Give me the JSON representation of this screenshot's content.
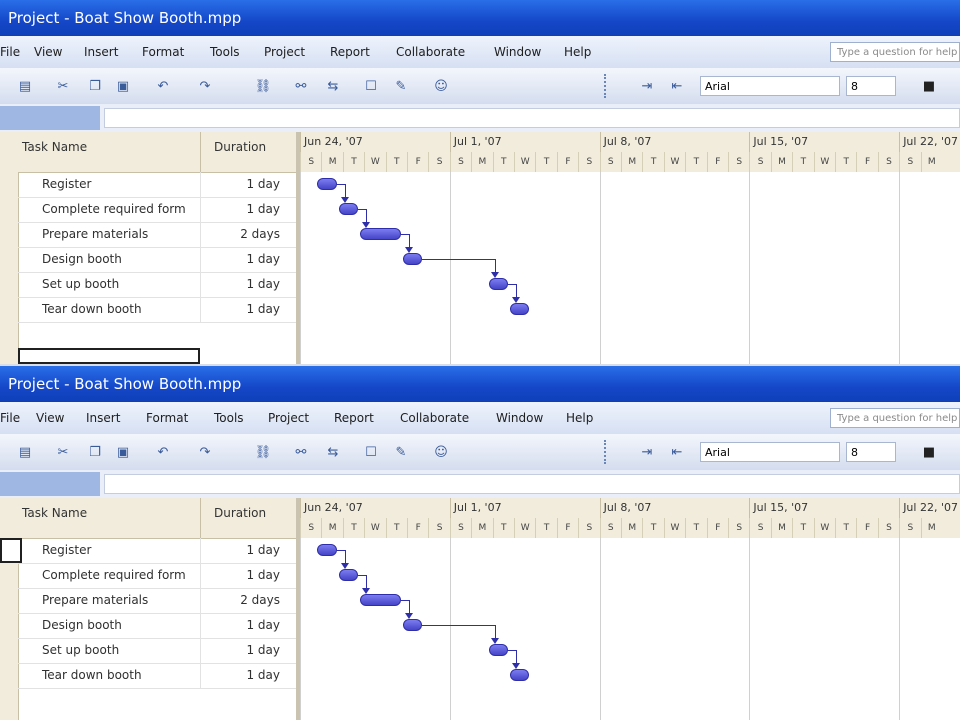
{
  "window_title": "Project - Boat Show Booth.mpp",
  "menu": [
    "File",
    "View",
    "Insert",
    "Format",
    "Tools",
    "Project",
    "Report",
    "Collaborate",
    "Window",
    "Help"
  ],
  "help_placeholder": "Type a question for help",
  "font_name": "Arial",
  "font_size": "8",
  "columns": {
    "task_name": "Task Name",
    "duration": "Duration"
  },
  "tasks": [
    {
      "name": "Register",
      "duration": "1 day"
    },
    {
      "name": "Complete required form",
      "duration": "1 day"
    },
    {
      "name": "Prepare materials",
      "duration": "2 days"
    },
    {
      "name": "Design booth",
      "duration": "1 day"
    },
    {
      "name": "Set up booth",
      "duration": "1 day"
    },
    {
      "name": "Tear down booth",
      "duration": "1 day"
    }
  ],
  "weeks": [
    "Jun 24, '07",
    "Jul 1, '07",
    "Jul 8, '07",
    "Jul 15, '07",
    "Jul 22, '07"
  ],
  "days": [
    "S",
    "M",
    "T",
    "W",
    "T",
    "F",
    "S"
  ],
  "icons": [
    "print-icon",
    "print-preview-icon",
    "cut-icon",
    "copy-icon",
    "paste-icon",
    "undo-icon",
    "redo-icon",
    "link-icon",
    "unlink-icon",
    "split-icon",
    "task-info-icon",
    "notes-icon",
    "assign-resources-icon",
    "indent-icon",
    "outdent-icon",
    "bold-icon"
  ]
}
